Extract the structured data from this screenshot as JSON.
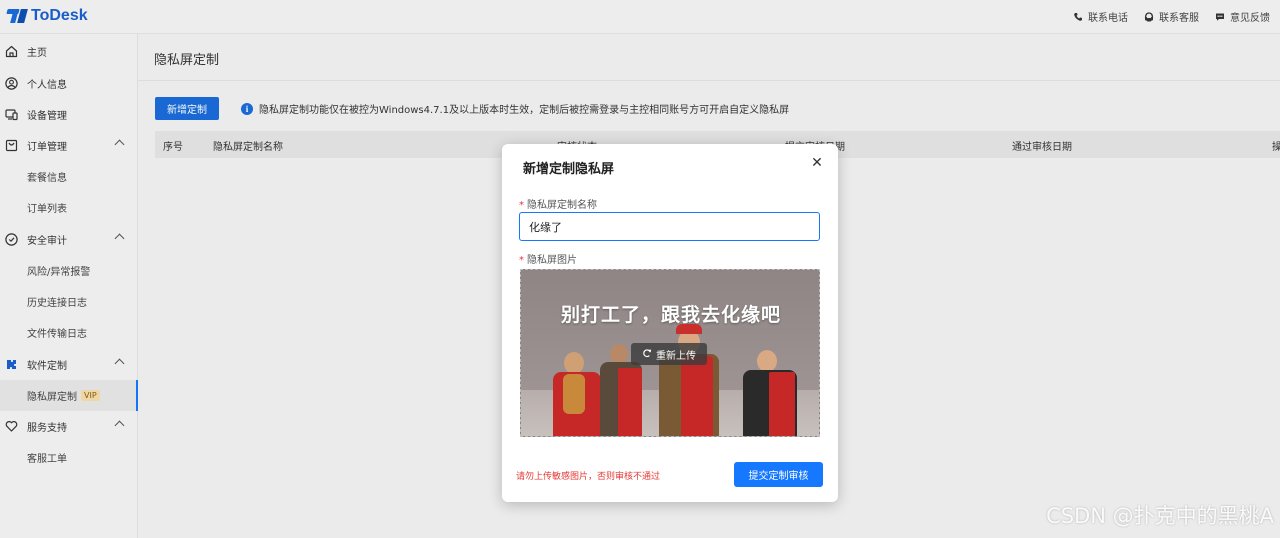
{
  "app": {
    "name": "ToDesk"
  },
  "header": {
    "actions": [
      {
        "label": "联系电话",
        "icon": "phone-icon"
      },
      {
        "label": "联系客服",
        "icon": "headset-icon"
      },
      {
        "label": "意见反馈",
        "icon": "chat-icon"
      }
    ]
  },
  "sidebar": {
    "home": "主页",
    "profile": "个人信息",
    "devices": "设备管理",
    "orders": "订单管理",
    "orders_plans": "套餐信息",
    "orders_list": "订单列表",
    "audit": "安全审计",
    "audit_risk": "风险/异常报警",
    "audit_history": "历史连接日志",
    "audit_files": "文件传输日志",
    "custom": "软件定制",
    "custom_privacy": "隐私屏定制",
    "custom_privacy_badge": "VIP",
    "support": "服务支持",
    "support_tickets": "客服工单"
  },
  "main": {
    "title": "隐私屏定制",
    "add_button": "新增定制",
    "notice": "隐私屏定制功能仅在被控为Windows4.7.1及以上版本时生效，定制后被控需登录与主控相同账号方可开启自定义隐私屏",
    "table_headers": [
      "序号",
      "隐私屏定制名称",
      "审核状态",
      "提交审核日期",
      "通过审核日期",
      "操作"
    ]
  },
  "modal": {
    "title": "新增定制隐私屏",
    "name_label": "隐私屏定制名称",
    "name_value": "化缘了",
    "image_label": "隐私屏图片",
    "image_caption": "别打工了，跟我去化缘吧",
    "reupload_label": "重新上传",
    "warning": "请勿上传敏感图片，否则审核不通过",
    "submit_label": "提交定制审核"
  },
  "watermark": "CSDN @扑克中的黑桃A"
}
